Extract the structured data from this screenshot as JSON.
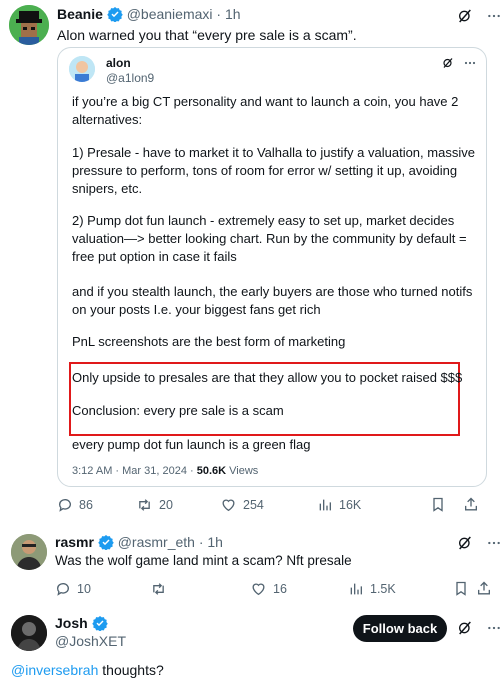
{
  "tweet1": {
    "name": "Beanie",
    "handle": "@beaniemaxi",
    "time": "1h",
    "text": "Alon warned you that  “every pre sale is a scam”.",
    "quote": {
      "name": "alon",
      "handle": "@a1lon9",
      "paragraphs": [
        "if you’re a big CT personality and want to launch a coin, you have 2 alternatives:",
        "1) Presale - have to market it to Valhalla to justify a valuation, massive pressure to perform, tons of room for error w/ setting it up, avoiding snipers, etc.",
        "2) Pump dot fun launch - extremely easy to set up, market decides valuation—> better looking chart. Run by the community by default = free put option in case it fails",
        "and if you stealth launch, the early buyers are those who turned notifs on your posts I.e. your biggest fans get rich",
        "PnL screenshots are the best form of marketing",
        "Only upside to presales are that they allow you to pocket raised $$$",
        "Conclusion: every pre sale is a scam",
        "every pump dot fun launch is a green flag"
      ],
      "time": "3:12 AM · Mar 31, 2024 ·",
      "views_count": "50.6K",
      "views_label": "Views"
    },
    "stats": {
      "replies": "86",
      "reposts": "20",
      "likes": "254",
      "views": "16K"
    }
  },
  "tweet2": {
    "name": "rasmr",
    "handle": "@rasmr_eth",
    "time": "1h",
    "text": "Was the wolf game land mint a scam? Nft presale",
    "stats": {
      "replies": "10",
      "reposts": "",
      "likes": "16",
      "views": "1.5K"
    }
  },
  "tweet3": {
    "name": "Josh",
    "handle": "@JoshXET",
    "follow_label": "Follow back",
    "mention": "@inversebrah",
    "text": " thoughts?"
  },
  "icons": [
    "verified-badge-icon",
    "grok-icon",
    "more-icon",
    "reply-icon",
    "repost-icon",
    "like-icon",
    "views-icon",
    "bookmark-icon",
    "share-icon"
  ],
  "colors": {
    "accent": "#1d9bf0",
    "highlight_border": "#e0191a",
    "text": "#0f1419",
    "muted": "#536471"
  }
}
